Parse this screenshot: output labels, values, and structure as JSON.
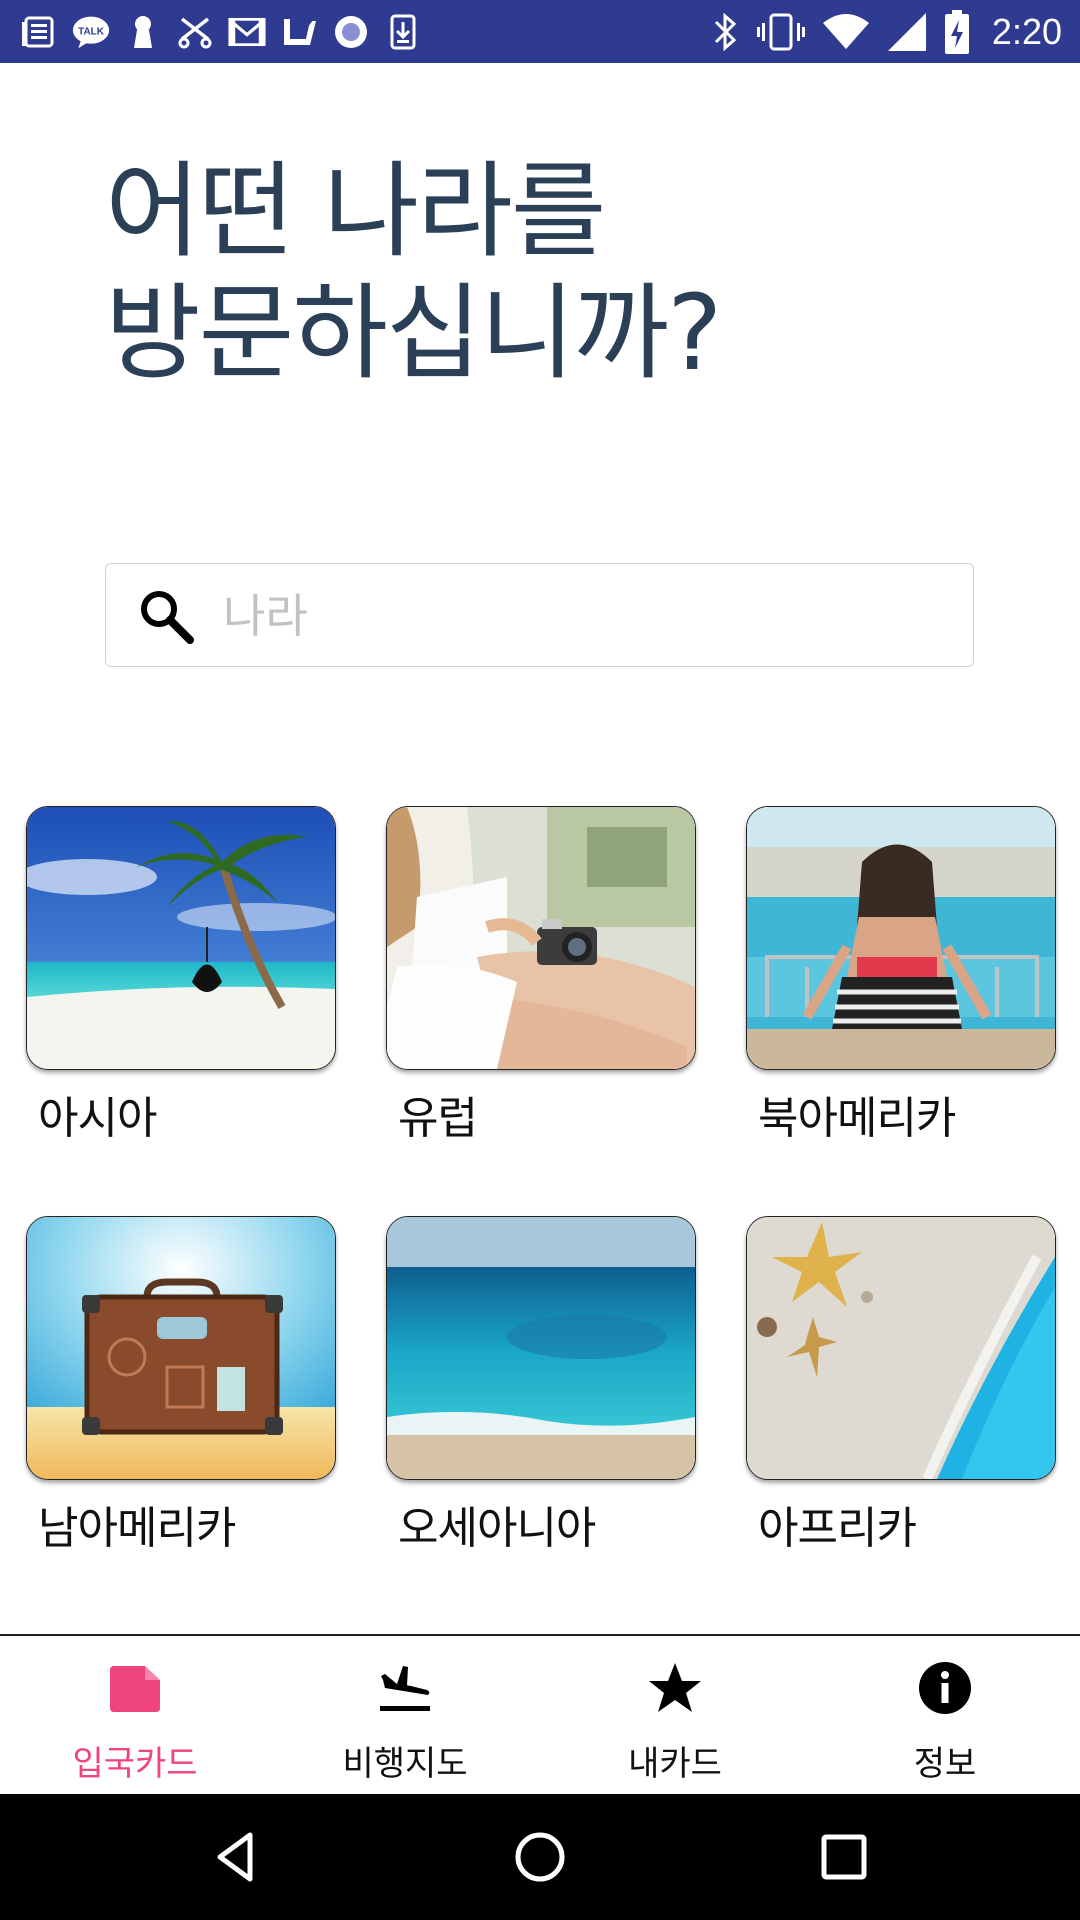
{
  "status_bar": {
    "time": "2:20",
    "notification_icons": [
      "news-icon",
      "talk-icon",
      "keyhole-icon",
      "scissors-icon",
      "gmail-icon",
      "check-icon",
      "circle-icon",
      "download-icon"
    ],
    "system_icons": [
      "bluetooth-icon",
      "vibrate-icon",
      "wifi-icon",
      "signal-icon",
      "battery-charging-icon"
    ],
    "talk_badge": "TALK"
  },
  "heading": {
    "line1": "어떤 나라를",
    "line2": "방문하십니까?"
  },
  "search": {
    "placeholder": "나라",
    "value": ""
  },
  "regions": [
    {
      "label": "아시아",
      "image": "beach-palm-hammock"
    },
    {
      "label": "유럽",
      "image": "woman-with-camera"
    },
    {
      "label": "북아메리카",
      "image": "woman-at-pool"
    },
    {
      "label": "남아메리카",
      "image": "vintage-suitcase"
    },
    {
      "label": "오세아니아",
      "image": "turquoise-sea"
    },
    {
      "label": "아프리카",
      "image": "starfish-on-sand"
    }
  ],
  "bottom_nav": {
    "items": [
      {
        "label": "입국카드",
        "icon": "card-icon",
        "active": true
      },
      {
        "label": "비행지도",
        "icon": "plane-landing-icon",
        "active": false
      },
      {
        "label": "내카드",
        "icon": "star-icon",
        "active": false
      },
      {
        "label": "정보",
        "icon": "info-icon",
        "active": false
      }
    ]
  },
  "system_nav": [
    "back-icon",
    "home-icon",
    "recents-icon"
  ],
  "colors": {
    "status_bar": "#2f3a91",
    "heading": "#2b3f56",
    "accent": "#f0447f",
    "search_border": "#cfd3d7",
    "placeholder": "#c2c2c2"
  }
}
